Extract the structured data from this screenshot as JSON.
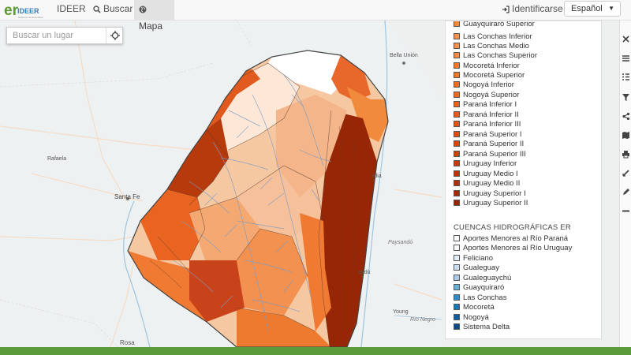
{
  "brand": {
    "logo_text": "IDEER",
    "tagline": "Gobierno de Entre Ríos"
  },
  "nav": {
    "ideer_label": "IDEER",
    "buscar_label": "Buscar",
    "mapa_label": "Mapa",
    "identificarse_label": "Identificarse",
    "language_selected": "Español"
  },
  "search": {
    "placeholder": "Buscar un lugar"
  },
  "map_labels": {
    "bella_union": "Bella Unión",
    "rafaela": "Rafaela",
    "santa_fe": "Santa Fe",
    "paysandu": "Paysandú",
    "paysandu2": "andú",
    "young": "Young",
    "rio_negro": "Río Negro",
    "rosario": "Rosa",
    "concordia": "rdia"
  },
  "legend": {
    "subcuencas": [
      {
        "label": "Guayquiraró Superior",
        "color": "#f08a3c"
      },
      {
        "label": "Las Conchas Inferior",
        "color": "#f39150"
      },
      {
        "label": "Las Conchas Medio",
        "color": "#f39150"
      },
      {
        "label": "Las Conchas Superior",
        "color": "#f38a48"
      },
      {
        "label": "Mocoretá Inferior",
        "color": "#f07a32"
      },
      {
        "label": "Mocoretá Superior",
        "color": "#ee7a30"
      },
      {
        "label": "Nogoyá Inferior",
        "color": "#ec7028"
      },
      {
        "label": "Nogoyá Superior",
        "color": "#ea6c24"
      },
      {
        "label": "Paraná Inferior I",
        "color": "#e86420"
      },
      {
        "label": "Paraná Inferior II",
        "color": "#e55d1c"
      },
      {
        "label": "Paraná Inferior III",
        "color": "#e05518"
      },
      {
        "label": "Paraná Superior I",
        "color": "#dc4e14"
      },
      {
        "label": "Paraná Superior II",
        "color": "#d64810"
      },
      {
        "label": "Paraná Superior III",
        "color": "#cf420e"
      },
      {
        "label": "Uruguay Inferior",
        "color": "#c43c0c"
      },
      {
        "label": "Uruguay Medio I",
        "color": "#b8360a"
      },
      {
        "label": "Uruguay Medio II",
        "color": "#ad300a"
      },
      {
        "label": "Uruguay Superior I",
        "color": "#a22b08"
      },
      {
        "label": "Uruguay Superior II",
        "color": "#962606"
      }
    ],
    "cuencas_title": "CUENCAS HIDROGRÁFICAS ER",
    "cuencas": [
      {
        "label": "Aportes Menores al Río Paraná",
        "color": "#ffffff"
      },
      {
        "label": "Aportes Menores al Río Uruguay",
        "color": "#ffffff"
      },
      {
        "label": "Feliciano",
        "color": "#e3eef8"
      },
      {
        "label": "Gualeguay",
        "color": "#c9dff1"
      },
      {
        "label": "Gualeguaychú",
        "color": "#a9cbe8"
      },
      {
        "label": "Guayquiraró",
        "color": "#6ab1da"
      },
      {
        "label": "Las Conchas",
        "color": "#2f8cc6"
      },
      {
        "label": "Mocoretá",
        "color": "#1a74b4"
      },
      {
        "label": "Nogoyá",
        "color": "#0f5ea0"
      },
      {
        "label": "Sistema Delta",
        "color": "#0a4a86"
      }
    ]
  }
}
